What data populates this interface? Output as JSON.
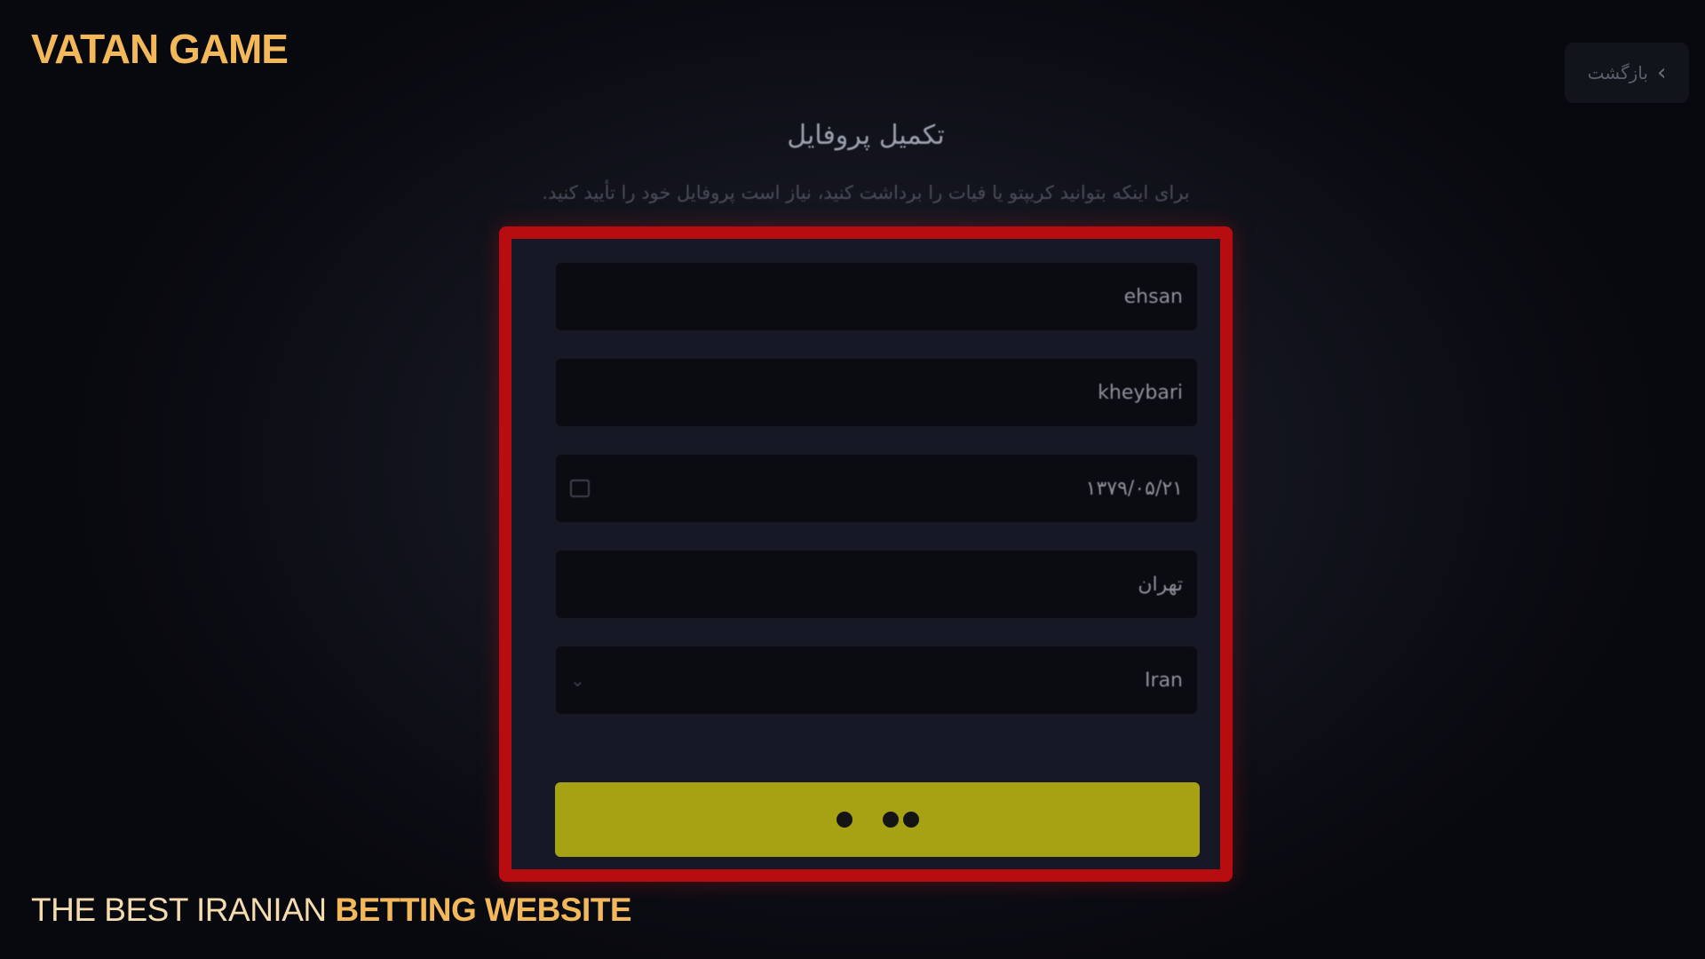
{
  "brand": {
    "name": "VATAN GAME",
    "tagline_regular": "THE BEST IRANIAN",
    "tagline_bold": "BETTING WEBSITE",
    "color": "#f2b85a"
  },
  "header": {
    "back_label": "بازگشت",
    "back_icon": "chevron-right-icon"
  },
  "form": {
    "title": "تکمیل پروفایل",
    "subtitle": "برای اینکه بتوانید کریپتو یا فیات را برداشت کنید، نیاز است پروفایل خود را تأیید کنید.",
    "first_name": "ehsan",
    "last_name": "kheybari",
    "birth_date": "۱۳۷۹/۰۵/۲۱",
    "birth_date_icon": "calendar-icon",
    "city": "تهران",
    "country": "Iran",
    "country_icon": "chevron-down-icon",
    "submit_state": "loading"
  },
  "colors": {
    "highlight_border": "#b80d10",
    "submit_button": "#a7a214"
  }
}
